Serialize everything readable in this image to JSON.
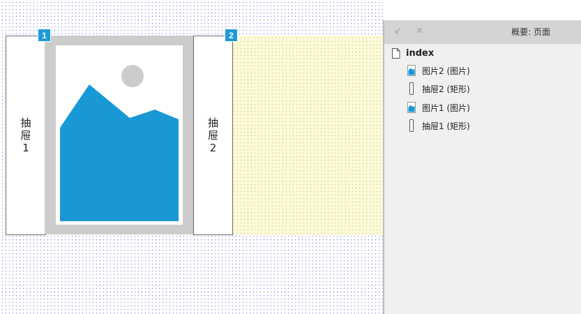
{
  "canvas": {
    "drawer1": {
      "label": "抽屉1"
    },
    "drawer2": {
      "label": "抽屉2"
    },
    "badge1": "1",
    "badge2": "2",
    "image_placeholder_icon": "image-placeholder-icon"
  },
  "panel": {
    "title": "概要: 页面",
    "collapse_icon": "arrow-collapse-icon",
    "close_icon": "close-icon",
    "tree": {
      "root": {
        "label": "index",
        "icon": "page-icon"
      },
      "items": [
        {
          "label": "图片2 (图片)",
          "icon": "image-widget-icon"
        },
        {
          "label": "抽屉2 (矩形)",
          "icon": "rectangle-widget-icon"
        },
        {
          "label": "图片1 (图片)",
          "icon": "image-widget-icon"
        },
        {
          "label": "抽屉1 (矩形)",
          "icon": "rectangle-widget-icon"
        }
      ]
    }
  },
  "colors": {
    "accent": "#1e9bd7",
    "image_blue": "#1899d5",
    "highlight": "#fdfbd6"
  }
}
